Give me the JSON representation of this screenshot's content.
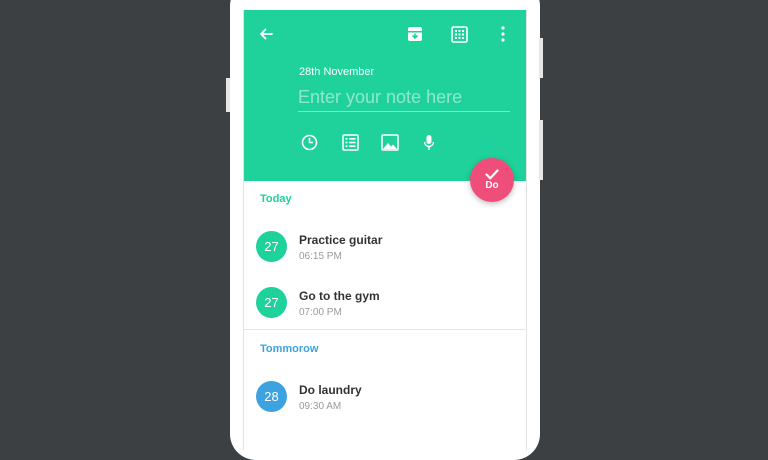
{
  "colors": {
    "header": "#1fd19a",
    "accent_today": "#1fd19a",
    "accent_tomorrow": "#3da2e0",
    "fab": "#ef4e7b",
    "background": "#3c4043"
  },
  "icons": {
    "back": "arrow-left-icon",
    "archive": "archive-icon",
    "calendar": "calendar-grid-icon",
    "menu": "more-vert-icon",
    "reminder": "clock-icon",
    "checklist": "list-icon",
    "image": "image-icon",
    "voice": "mic-icon",
    "fab": "check-icon"
  },
  "header": {
    "date": "28th November",
    "note_placeholder": "Enter your note here"
  },
  "fab": {
    "label": "Do"
  },
  "sections": [
    {
      "label": "Today",
      "tasks": [
        {
          "day": "27",
          "title": "Practice guitar",
          "time": "06:15 PM"
        },
        {
          "day": "27",
          "title": "Go to the gym",
          "time": "07:00 PM"
        }
      ]
    },
    {
      "label": "Tommorow",
      "tasks": [
        {
          "day": "28",
          "title": "Do laundry",
          "time": "09:30 AM"
        }
      ]
    }
  ]
}
